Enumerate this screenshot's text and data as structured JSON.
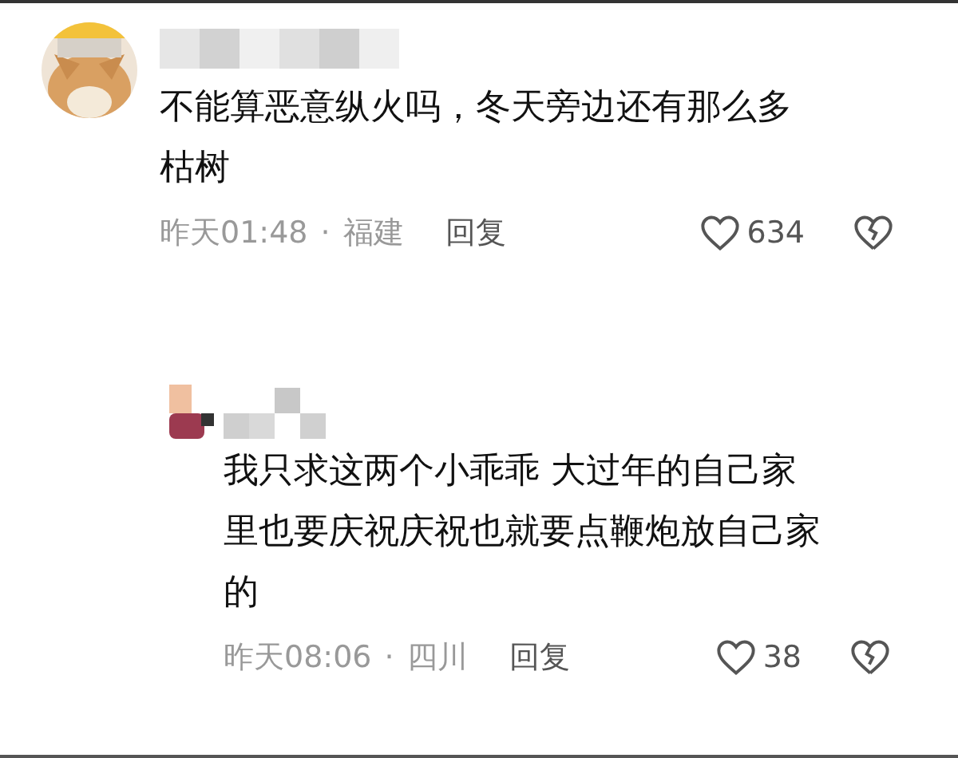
{
  "comments": [
    {
      "text": "不能算恶意纵火吗，冬天旁边还有那么多枯树",
      "time": "昨天01:48",
      "separator": "·",
      "location": "福建",
      "reply": "回复",
      "likes": "634"
    },
    {
      "text": "我只求这两个小乖乖 大过年的自己家里也要庆祝庆祝也就要点鞭炮放自己家的",
      "time": "昨天08:06",
      "separator": "·",
      "location": "四川",
      "reply": "回复",
      "likes": "38"
    }
  ]
}
